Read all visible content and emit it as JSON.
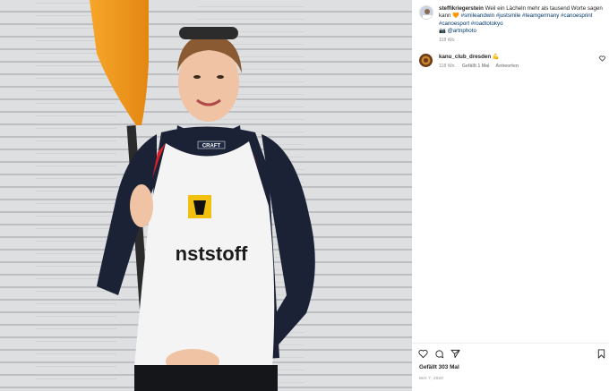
{
  "post": {
    "username": "steffikriegerstein",
    "caption_text": "Weil ein Lächeln mehr als tausend Worte sagen kann",
    "heart_emoji": "🧡",
    "hashtags": "#smileandwin #justsmile #teamgermany #canoesprint #canoesport #roadtotokyo",
    "photo_credit_icon": "📷",
    "photo_credit": "@artnphoto",
    "caption_time": "118 Wo.",
    "likes": "Gefällt 303 Mal",
    "date": "MAI 7, 2020"
  },
  "comment": {
    "username": "kanu_club_dresden",
    "emoji": "💪",
    "time": "118 Wo.",
    "likes": "Gefällt 1 Mal",
    "reply": "Antworten"
  },
  "photo": {
    "shirt_brand": "CRAFT",
    "shirt_text": "nststoff",
    "paddle_color": "#f29a1f"
  },
  "icons": {
    "like": "heart-icon",
    "comment": "comment-icon",
    "share": "share-icon",
    "save": "bookmark-icon",
    "comment_like": "heart-small-icon"
  }
}
